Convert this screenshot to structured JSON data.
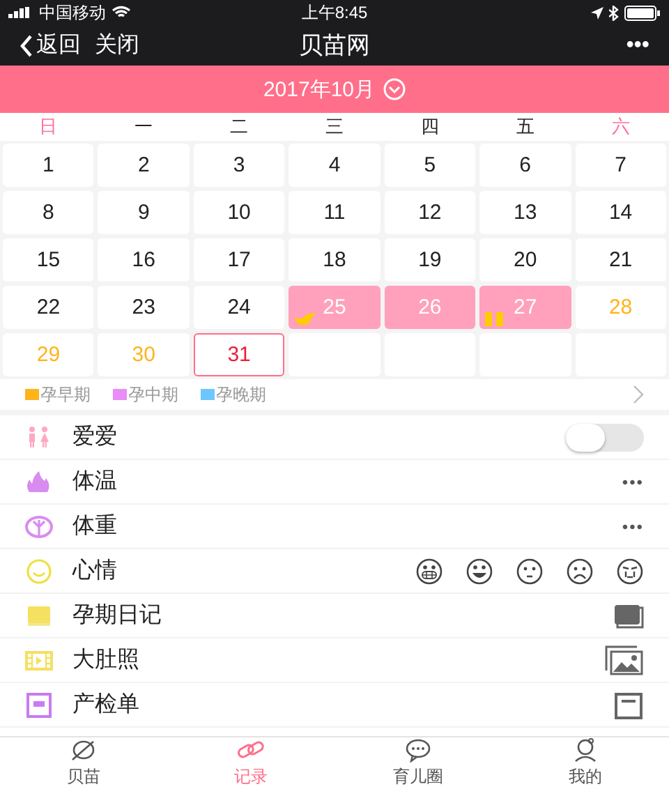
{
  "status_bar": {
    "carrier": "中国移动",
    "time": "上午8:45"
  },
  "nav": {
    "back": "返回",
    "close": "关闭",
    "title": "贝苗网",
    "more": "•••"
  },
  "month": {
    "label": "2017年10月"
  },
  "weekdays": [
    {
      "label": "日",
      "weekend": true
    },
    {
      "label": "一",
      "weekend": false
    },
    {
      "label": "二",
      "weekend": false
    },
    {
      "label": "三",
      "weekend": false
    },
    {
      "label": "四",
      "weekend": false
    },
    {
      "label": "五",
      "weekend": false
    },
    {
      "label": "六",
      "weekend": true
    }
  ],
  "days": [
    {
      "day": "1",
      "kind": "plain"
    },
    {
      "day": "2",
      "kind": "plain"
    },
    {
      "day": "3",
      "kind": "plain"
    },
    {
      "day": "4",
      "kind": "plain"
    },
    {
      "day": "5",
      "kind": "plain"
    },
    {
      "day": "6",
      "kind": "plain"
    },
    {
      "day": "7",
      "kind": "plain"
    },
    {
      "day": "8",
      "kind": "plain"
    },
    {
      "day": "9",
      "kind": "plain"
    },
    {
      "day": "10",
      "kind": "plain"
    },
    {
      "day": "11",
      "kind": "plain"
    },
    {
      "day": "12",
      "kind": "plain"
    },
    {
      "day": "13",
      "kind": "plain"
    },
    {
      "day": "14",
      "kind": "plain"
    },
    {
      "day": "15",
      "kind": "plain"
    },
    {
      "day": "16",
      "kind": "plain"
    },
    {
      "day": "17",
      "kind": "plain"
    },
    {
      "day": "18",
      "kind": "plain"
    },
    {
      "day": "19",
      "kind": "plain"
    },
    {
      "day": "20",
      "kind": "plain"
    },
    {
      "day": "21",
      "kind": "plain"
    },
    {
      "day": "22",
      "kind": "plain"
    },
    {
      "day": "23",
      "kind": "plain"
    },
    {
      "day": "24",
      "kind": "plain"
    },
    {
      "day": "25",
      "kind": "period",
      "marker": {
        "kind": "bird"
      }
    },
    {
      "day": "26",
      "kind": "period"
    },
    {
      "day": "27",
      "kind": "period",
      "marker": {
        "kind": "bars"
      }
    },
    {
      "day": "28",
      "kind": "upcoming"
    },
    {
      "day": "29",
      "kind": "upcoming"
    },
    {
      "day": "30",
      "kind": "upcoming"
    },
    {
      "day": "31",
      "kind": "today"
    }
  ],
  "legend": [
    {
      "label": "孕早期",
      "color": "#ffb31a"
    },
    {
      "label": "孕中期",
      "color": "#e98cf7"
    },
    {
      "label": "孕晚期",
      "color": "#6ec6ff"
    }
  ],
  "records": [
    {
      "label": "爱爱",
      "kind": "toggle",
      "on": false
    },
    {
      "label": "体温",
      "kind": "more",
      "more": "•••"
    },
    {
      "label": "体重",
      "kind": "more",
      "more": "•••"
    },
    {
      "label": "心情",
      "kind": "moods"
    },
    {
      "label": "孕期日记",
      "kind": "book"
    },
    {
      "label": "大肚照",
      "kind": "photo"
    },
    {
      "label": "产检单",
      "kind": "form"
    }
  ],
  "tabs": [
    {
      "label": "贝苗",
      "selected": false
    },
    {
      "label": "记录",
      "selected": true
    },
    {
      "label": "育儿圈",
      "selected": false
    },
    {
      "label": "我的",
      "selected": false
    }
  ]
}
